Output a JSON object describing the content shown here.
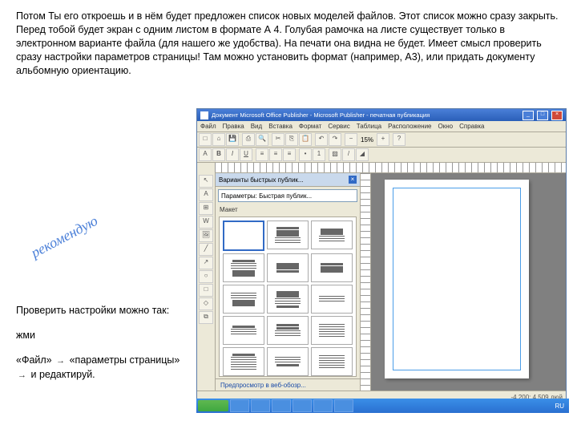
{
  "main_paragraph": "Потом Ты его откроешь и в нём будет предложен список новых моделей файлов. Этот список можно сразу закрыть. Перед тобой будет экран с одним листом в формате А 4. Голубая рамочка на листе существует только в электронном варианте файла (для нашего же удобства). На печати она видна не будет. Имеет смысл проверить сразу настройки параметров страницы! Там можно установить формат (например, А3), или придать документу альбомную ориентацию.",
  "recommend": "рекомендую",
  "check": {
    "line1": "Проверить настройки можно так:",
    "line2": "жми",
    "file": "«Файл»",
    "params": "«параметры страницы»",
    "edit": "и редактируй."
  },
  "app": {
    "title": "Документ Microsoft Office Publisher - Microsoft Publisher - печатная публикация",
    "menu": [
      "Файл",
      "Правка",
      "Вид",
      "Вставка",
      "Формат",
      "Сервис",
      "Таблица",
      "Расположение",
      "Окно",
      "Справка"
    ],
    "zoom": "15%",
    "panel_header": "Варианты быстрых публик...",
    "panel_sub": "Параметры: Быстрая публик...",
    "panel_label": "Макет",
    "bottom_link": "Предпросмотр в веб-обозр...",
    "status_right": "-4,200; 4,509 дюй",
    "clock": "RU"
  }
}
